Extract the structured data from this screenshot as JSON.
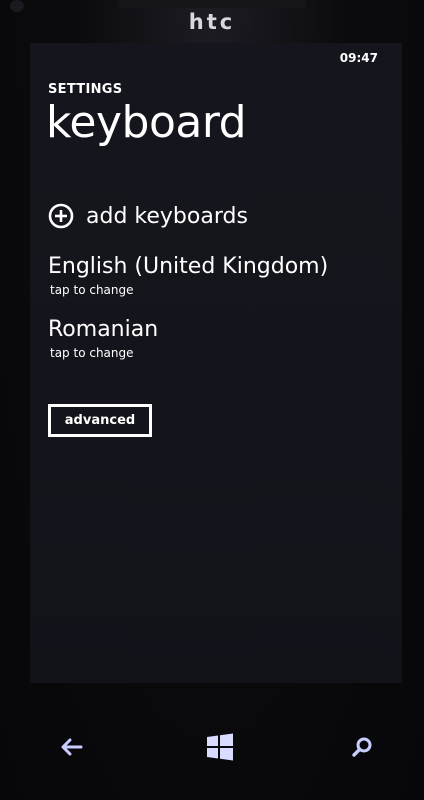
{
  "device": {
    "brand": "htc"
  },
  "status_bar": {
    "time": "09:47"
  },
  "header": {
    "section": "SETTINGS",
    "title": "keyboard"
  },
  "add_keyboards": {
    "label": "add keyboards",
    "icon": "plus-circle-icon"
  },
  "keyboards": [
    {
      "name": "English (United Kingdom)",
      "hint": "tap to change"
    },
    {
      "name": "Romanian",
      "hint": "tap to change"
    }
  ],
  "advanced_button": {
    "label": "advanced"
  },
  "nav": {
    "back_icon": "back-arrow-icon",
    "start_icon": "windows-logo-icon",
    "search_icon": "search-icon",
    "glow_color": "#5b6cff"
  },
  "colors": {
    "screen_bg": "#15161d",
    "text": "#ffffff"
  }
}
